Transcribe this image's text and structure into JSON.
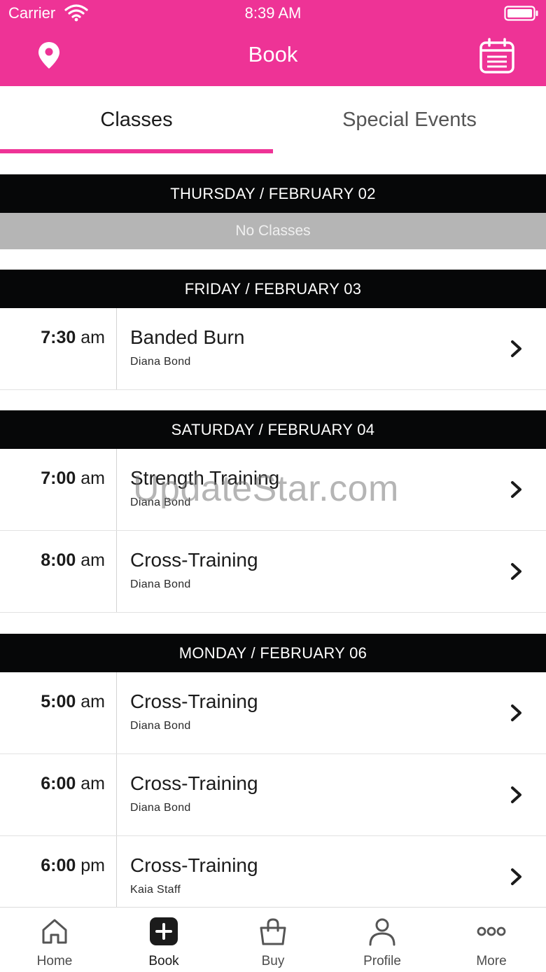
{
  "status_bar": {
    "carrier": "Carrier",
    "time": "8:39 AM"
  },
  "nav": {
    "title": "Book",
    "left_icon": "location-pin-icon",
    "right_icon": "calendar-icon"
  },
  "tabs": [
    {
      "label": "Classes",
      "active": true
    },
    {
      "label": "Special Events",
      "active": false
    }
  ],
  "accent_color": "#ee3396",
  "days": [
    {
      "header": "THURSDAY / FEBRUARY 02",
      "empty_label": "No Classes"
    },
    {
      "header": "FRIDAY / FEBRUARY 03",
      "classes": [
        {
          "time": "7:30",
          "ampm": "am",
          "name": "Banded Burn",
          "instructor": "Diana Bond"
        }
      ]
    },
    {
      "header": "SATURDAY / FEBRUARY 04",
      "classes": [
        {
          "time": "7:00",
          "ampm": "am",
          "name": "Strength Training",
          "instructor": "Diana Bond"
        },
        {
          "time": "8:00",
          "ampm": "am",
          "name": "Cross-Training",
          "instructor": "Diana Bond"
        }
      ]
    },
    {
      "header": "MONDAY / FEBRUARY 06",
      "classes": [
        {
          "time": "5:00",
          "ampm": "am",
          "name": "Cross-Training",
          "instructor": "Diana Bond"
        },
        {
          "time": "6:00",
          "ampm": "am",
          "name": "Cross-Training",
          "instructor": "Diana Bond"
        },
        {
          "time": "6:00",
          "ampm": "pm",
          "name": "Cross-Training",
          "instructor": "Kaia Staff"
        }
      ]
    }
  ],
  "watermark": "UpdateStar.com",
  "tab_bar": [
    {
      "label": "Home",
      "icon": "home-icon"
    },
    {
      "label": "Book",
      "icon": "plus-square-icon",
      "active": true
    },
    {
      "label": "Buy",
      "icon": "shopping-bag-icon"
    },
    {
      "label": "Profile",
      "icon": "person-icon"
    },
    {
      "label": "More",
      "icon": "more-dots-icon"
    }
  ]
}
